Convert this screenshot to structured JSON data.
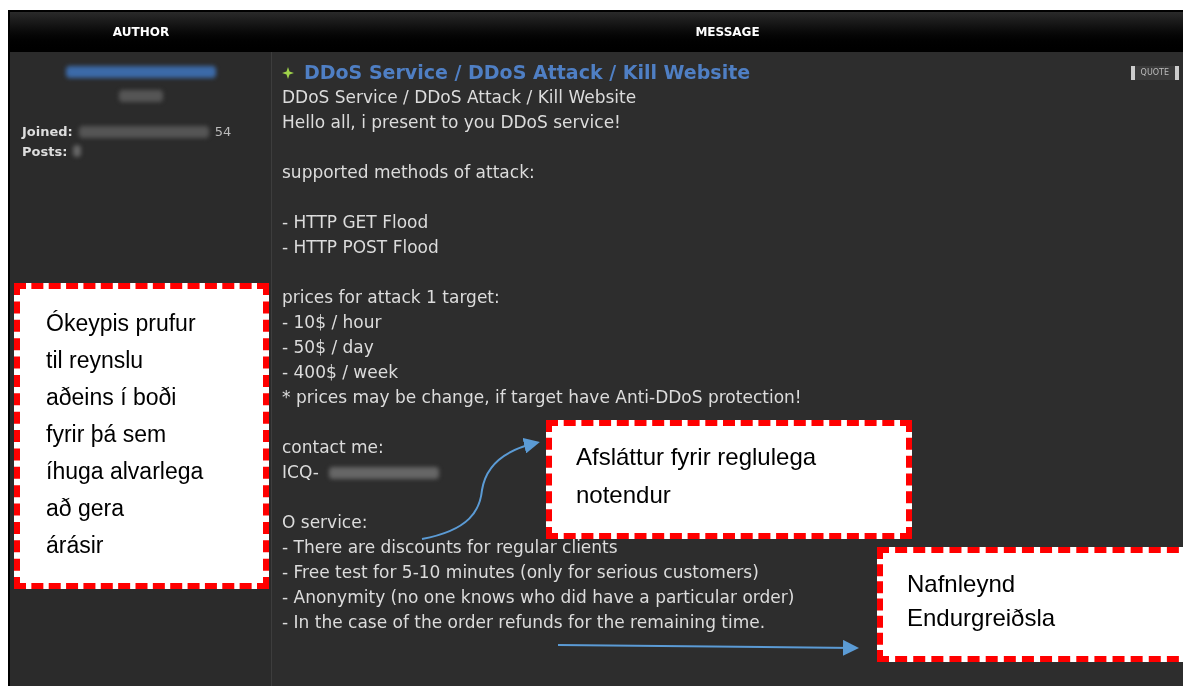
{
  "table": {
    "columns": [
      "AUTHOR",
      "MESSAGE"
    ]
  },
  "author": {
    "joined_label": "Joined:",
    "joined_tail": "54",
    "posts_label": "Posts:"
  },
  "post": {
    "title": "DDoS Service / DDoS Attack / Kill Website",
    "quote_button": "QUOTE",
    "paragraphs": [
      [
        "DDoS Service / DDoS Attack / Kill Website",
        "Hello all, i present to you DDoS service!"
      ],
      [
        "supported methods of attack:"
      ],
      [
        "- HTTP GET Flood",
        "- HTTP POST Flood"
      ],
      [
        "prices for attack 1 target:",
        "- 10$ / hour",
        "- 50$ / day",
        "- 400$ / week",
        "* prices may be change, if target have Anti-DDoS protection!"
      ],
      [
        "contact me:",
        "ICQ-"
      ],
      [
        "O service:",
        "- There are discounts for regular clients",
        "- Free test for 5-10 minutes (only for serious customers)",
        "- Anonymity (no one knows who did have a particular order)",
        "- In the case of the order refunds for the remaining time."
      ]
    ]
  },
  "annotations": [
    {
      "lines": [
        "Ókeypis prufur",
        "til reynslu",
        "aðeins í boði",
        "fyrir þá sem",
        "íhuga alvarlega",
        "að gera",
        "árásir"
      ]
    },
    {
      "lines": [
        "Afsláttur fyrir reglulega",
        "notendur"
      ]
    },
    {
      "lines": [
        "Nafnleynd",
        "Endurgreiðsla"
      ]
    }
  ]
}
